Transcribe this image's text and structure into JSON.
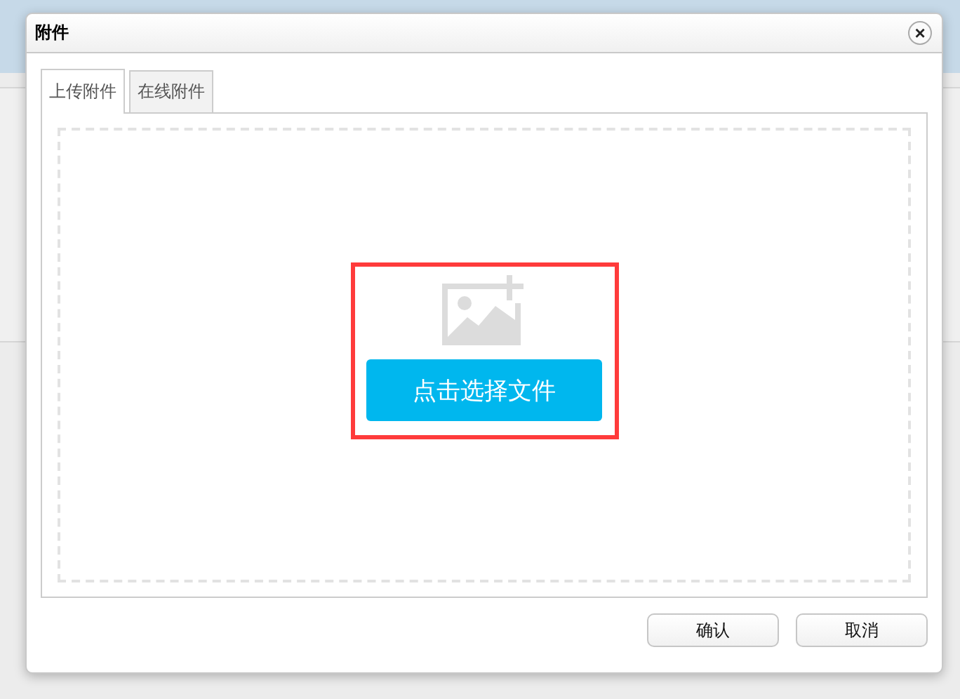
{
  "dialog": {
    "title": "附件",
    "close_label": "×"
  },
  "tabs": [
    {
      "label": "上传附件",
      "selected": true
    },
    {
      "label": "在线附件",
      "selected": false
    }
  ],
  "upload": {
    "button": "点击选择文件",
    "highlighted": true
  },
  "buttons": [
    "确认",
    "取消"
  ]
}
